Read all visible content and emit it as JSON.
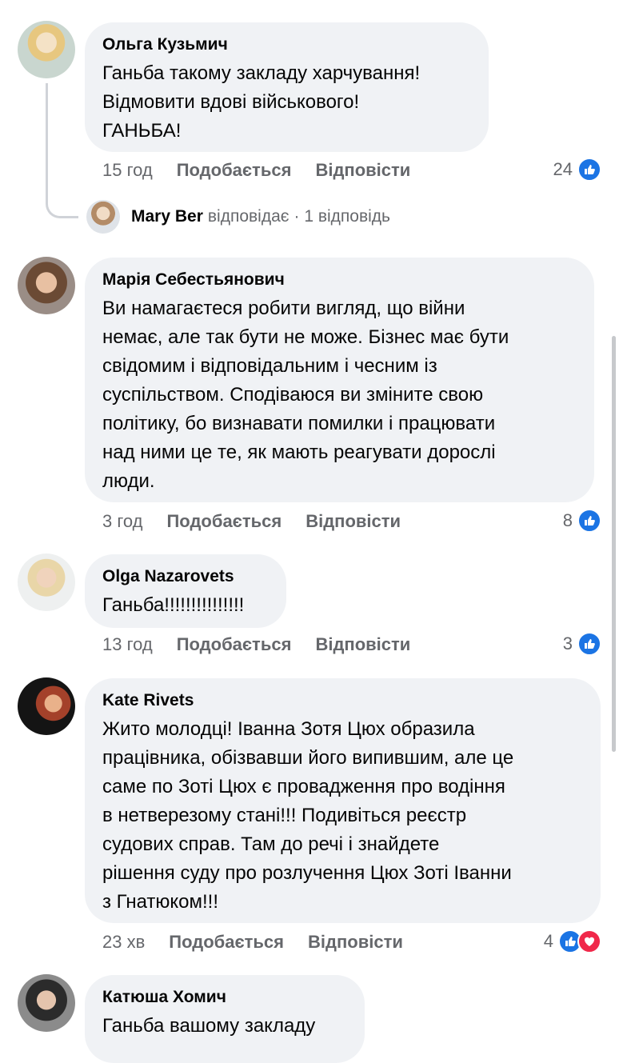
{
  "comments": [
    {
      "author": "Ольга Кузьмич",
      "text": "Ганьба такому закладу харчування!\nВідмовити вдові військового!\nГАНЬБА!",
      "time": "15 год",
      "like_label": "Подобається",
      "reply_label": "Відповісти",
      "reactions": "24",
      "reply_thread": {
        "name": "Mary Ber",
        "verb": "відповідає",
        "count": "· 1 відповідь"
      }
    },
    {
      "author": "Марія Себестьянович",
      "text": "Ви намагаєтеся робити вигляд, що війни\nнемає, але так бути не може. Бізнес має бути\nсвідомим і відповідальним і чесним із\nсуспільством. Сподіваюся ви зміните свою\nполітику, бо визнавати помилки і працювати\nнад ними це те, як мають реагувати дорослі\nлюди.",
      "time": "3 год",
      "like_label": "Подобається",
      "reply_label": "Відповісти",
      "reactions": "8"
    },
    {
      "author": "Olga Nazarovets",
      "text": "Ганьба!!!!!!!!!!!!!!!",
      "time": "13 год",
      "like_label": "Подобається",
      "reply_label": "Відповісти",
      "reactions": "3"
    },
    {
      "author": "Kate Rivets",
      "text": "Жито молодці! Іванна Зотя Цюх образила\nпрацівника, обізвавши його випившим, але це\nсаме по Зоті Цюх є провадження про водіння\nв нетверезому стані!!! Подивіться реєстр\nсудових справ. Там до речі і знайдете\nрішення суду про розлучення Цюх Зоті Іванни\nз Гнатюком!!!",
      "time": "23 хв",
      "like_label": "Подобається",
      "reply_label": "Відповісти",
      "reactions": "4"
    },
    {
      "author": "Катюша Хомич",
      "text": "Ганьба вашому закладу"
    }
  ],
  "icons": {
    "like": "like-icon",
    "love": "heart-icon"
  },
  "colors": {
    "like_blue": "#1b74e4",
    "love_red": "#f0284a",
    "bubble_bg": "#f0f2f5",
    "meta_grey": "#65676b"
  }
}
